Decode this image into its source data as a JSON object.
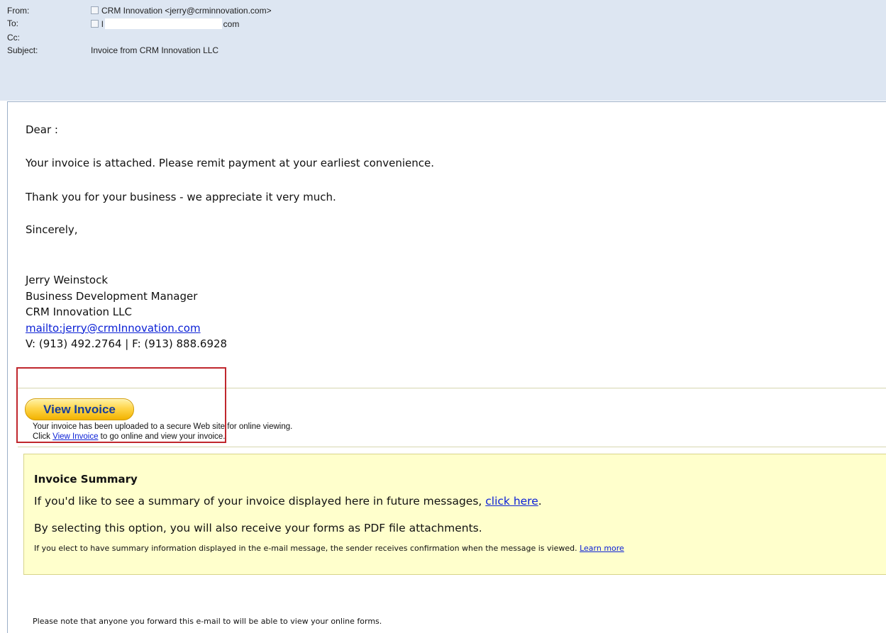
{
  "header": {
    "from_label": "From:",
    "from_value": "CRM Innovation <jerry@crminnovation.com>",
    "to_label": "To:",
    "to_prefix": "l",
    "to_suffix": "com",
    "cc_label": "Cc:",
    "subject_label": "Subject:",
    "subject_value": "Invoice from CRM Innovation LLC"
  },
  "body": {
    "greeting": "Dear          :",
    "para1": "Your invoice is attached. Please remit payment at your earliest convenience.",
    "para2": "Thank you for your business - we appreciate it very much.",
    "closing": "Sincerely,",
    "signature": {
      "name": "Jerry Weinstock",
      "title": "Business Development Manager",
      "company": "CRM Innovation LLC",
      "email_link": "mailto:jerry@crmInnovation.com",
      "phones": "V: (913) 492.2764 | F: (913) 888.6928"
    }
  },
  "invoice": {
    "button_label": "View Invoice",
    "line1": "Your invoice has been uploaded to a secure Web site for online viewing.",
    "line2_before": "Click ",
    "line2_link": "View Invoice",
    "line2_after": " to go online and view your invoice."
  },
  "summary": {
    "title": "Invoice Summary",
    "p1_before": "If you'd like to see a summary of your invoice displayed here in future messages, ",
    "p1_link": "click here",
    "p1_after": ".",
    "p2": "By selecting this option, you will also receive your forms as PDF file attachments.",
    "small_before": "If you elect to have summary information displayed in the e-mail message, the sender receives confirmation when the message is viewed.  ",
    "small_link": "Learn more"
  },
  "footer_note": "Please note that anyone you forward this e-mail to will be able to view your online forms.",
  "colors": {
    "header_bg": "#dde6f2",
    "summary_bg": "#ffffcc",
    "highlight_box": "#c0272d",
    "link": "#0b20d6",
    "button_text": "#163d9b"
  }
}
